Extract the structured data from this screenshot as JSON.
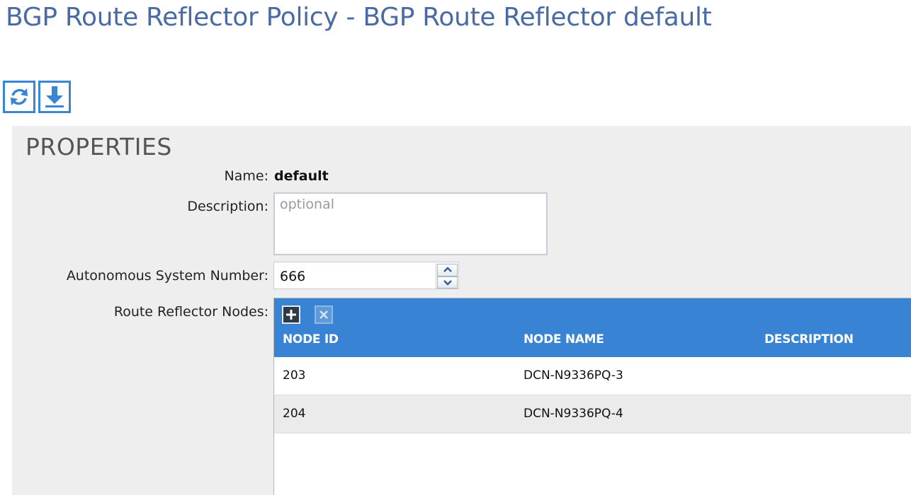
{
  "page": {
    "title": "BGP Route Reflector Policy - BGP Route Reflector default"
  },
  "toolbar": {
    "refresh_icon": "refresh-icon",
    "download_icon": "download-icon"
  },
  "properties": {
    "heading": "PROPERTIES",
    "name": {
      "label": "Name:",
      "value": "default"
    },
    "description": {
      "label": "Description:",
      "value": "",
      "placeholder": "optional"
    },
    "asn": {
      "label": "Autonomous System Number:",
      "value": "666"
    },
    "nodes": {
      "label": "Route Reflector Nodes:",
      "columns": [
        "NODE ID",
        "NODE NAME",
        "DESCRIPTION"
      ],
      "rows": [
        {
          "node_id": "203",
          "node_name": "DCN-N9336PQ-3",
          "description": ""
        },
        {
          "node_id": "204",
          "node_name": "DCN-N9336PQ-4",
          "description": ""
        }
      ]
    }
  },
  "colors": {
    "title": "#4a6aa5",
    "accent": "#3983d4",
    "panel_bg": "#eeeeee"
  }
}
